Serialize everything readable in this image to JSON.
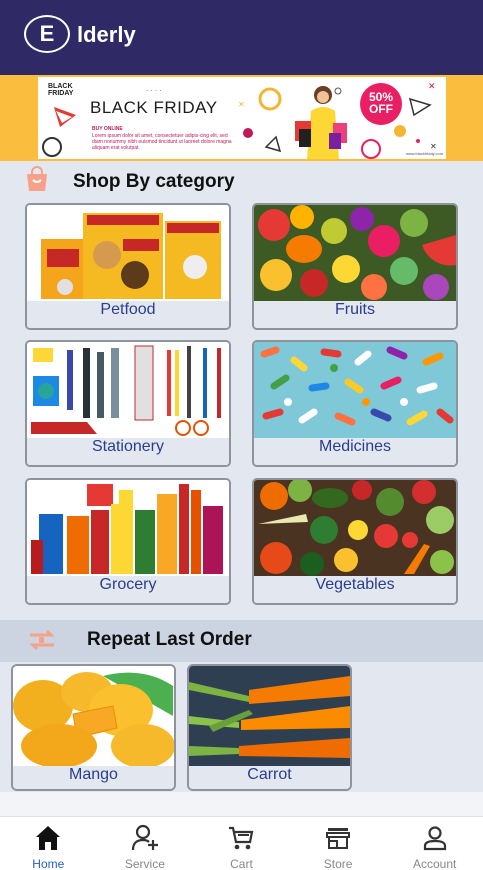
{
  "header": {
    "logo_letter": "E",
    "logo_text": "lderly"
  },
  "banner": {
    "small_label": "BLACK FRIDAY",
    "title": "BLACK FRIDAY",
    "buy_online": "BUY ONLINE",
    "body": "Lorem ipsum dolor sit amet, consectetuer adipis-cing elit, sed diam nonummy nibh euismod tincidunt ut laoreet dolore magna aliquam erat volutpat.",
    "discount": "50% OFF",
    "url": "www.blackfriday.com"
  },
  "category_section": {
    "title": "Shop By category",
    "items": [
      {
        "label": "Petfood"
      },
      {
        "label": "Fruits"
      },
      {
        "label": "Stationery"
      },
      {
        "label": "Medicines"
      },
      {
        "label": "Grocery"
      },
      {
        "label": "Vegetables"
      }
    ]
  },
  "repeat_section": {
    "title": "Repeat Last Order",
    "items": [
      {
        "label": "Mango"
      },
      {
        "label": "Carrot"
      }
    ]
  },
  "bottom_nav": {
    "items": [
      {
        "label": "Home",
        "icon": "home-icon",
        "active": true
      },
      {
        "label": "Service",
        "icon": "person-add-icon"
      },
      {
        "label": "Cart",
        "icon": "cart-icon"
      },
      {
        "label": "Store",
        "icon": "store-icon"
      },
      {
        "label": "Account",
        "icon": "account-icon"
      }
    ]
  },
  "colors": {
    "header": "#2f2a66",
    "banner_bg": "#fbbd3e",
    "label_text": "#2a3d8f",
    "active_nav": "#2461b8"
  }
}
